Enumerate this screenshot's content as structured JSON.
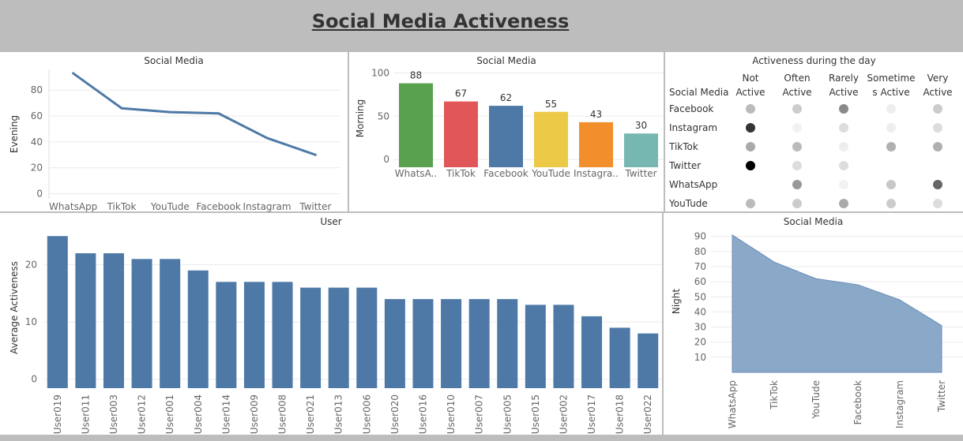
{
  "page": {
    "title": "Social Media Activeness"
  },
  "evening": {
    "title": "Social Media",
    "ylabel": "Evening",
    "color": "#4e79a7"
  },
  "morning": {
    "title": "Social Media",
    "ylabel": "Morning"
  },
  "matrix": {
    "title": "Activeness during the day",
    "row_header": "Social Media",
    "columns": [
      [
        "Not",
        "Active"
      ],
      [
        "Often",
        "Active"
      ],
      [
        "Rarely",
        "Active"
      ],
      [
        "Sometime",
        "s Active"
      ],
      [
        "Very",
        "Active"
      ]
    ],
    "rows": [
      "Facebook",
      "Instagram",
      "TikTok",
      "Twitter",
      "WhatsApp",
      "YouTude"
    ],
    "cells": [
      [
        "#bbbbbb",
        "#cccccc",
        "#8a8a8a",
        "#eeeeee",
        "#cccccc"
      ],
      [
        "#333333",
        "#f2f2f2",
        "#dddddd",
        "#eeeeee",
        "#dddddd"
      ],
      [
        "#aaaaaa",
        "#bbbbbb",
        "#eeeeee",
        "#b0b0b0",
        "#b0b0b0"
      ],
      [
        "#000000",
        "#dddddd",
        "#dddddd",
        null,
        null
      ],
      [
        null,
        "#999999",
        "#f2f2f2",
        "#c8c8c8",
        "#666666"
      ],
      [
        "#bbbbbb",
        "#cccccc",
        "#aaaaaa",
        "#cccccc",
        "#dddddd"
      ]
    ]
  },
  "user": {
    "title": "User",
    "ylabel": "Average Activeness",
    "color": "#4e79a7"
  },
  "night": {
    "title": "Social Media",
    "ylabel": "Night",
    "color": "#8aa8c8",
    "stroke": "#6b8eb8"
  },
  "chart_data": [
    {
      "id": "evening",
      "type": "line",
      "categories": [
        "WhatsApp",
        "TikTok",
        "YouTude",
        "Facebook",
        "Instagram",
        "Twitter"
      ],
      "values": [
        93,
        66,
        63,
        62,
        43,
        30
      ],
      "ylabel": "Evening",
      "yticks": [
        0,
        20,
        40,
        60,
        80
      ],
      "ylim": [
        -4,
        96
      ]
    },
    {
      "id": "morning",
      "type": "bar",
      "categories": [
        "WhatsA..",
        "TikTok",
        "Facebook",
        "YouTude",
        "Instagra..",
        "Twitter"
      ],
      "values": [
        88,
        67,
        62,
        55,
        43,
        30
      ],
      "colors": [
        "#59a14f",
        "#e15759",
        "#4e79a7",
        "#edc948",
        "#f28e2b",
        "#76b7b2"
      ],
      "ylabel": "Morning",
      "yticks": [
        0,
        50,
        100
      ],
      "ylim": [
        -9,
        104
      ]
    },
    {
      "id": "user",
      "type": "bar",
      "categories": [
        "User019",
        "User011",
        "User003",
        "User012",
        "User001",
        "User004",
        "User014",
        "User009",
        "User008",
        "User021",
        "User013",
        "User006",
        "User020",
        "User016",
        "User010",
        "User007",
        "User005",
        "User015",
        "User002",
        "User017",
        "User018",
        "User022"
      ],
      "values": [
        25,
        22,
        22,
        21,
        21,
        19,
        17,
        17,
        17,
        16,
        16,
        16,
        14,
        14,
        14,
        14,
        14,
        13,
        13,
        11,
        9,
        8
      ],
      "ylabel": "Average Activeness",
      "yticks": [
        0,
        10,
        20
      ],
      "ylim": [
        -1,
        26
      ]
    },
    {
      "id": "night",
      "type": "area",
      "categories": [
        "WhatsApp",
        "TikTok",
        "YouTude",
        "Facebook",
        "Instagram",
        "Twitter"
      ],
      "values": [
        91,
        73,
        62,
        58,
        48,
        31
      ],
      "ylabel": "Night",
      "yticks": [
        10,
        20,
        30,
        40,
        50,
        60,
        70,
        80,
        90
      ],
      "ylim": [
        0,
        94
      ]
    }
  ]
}
